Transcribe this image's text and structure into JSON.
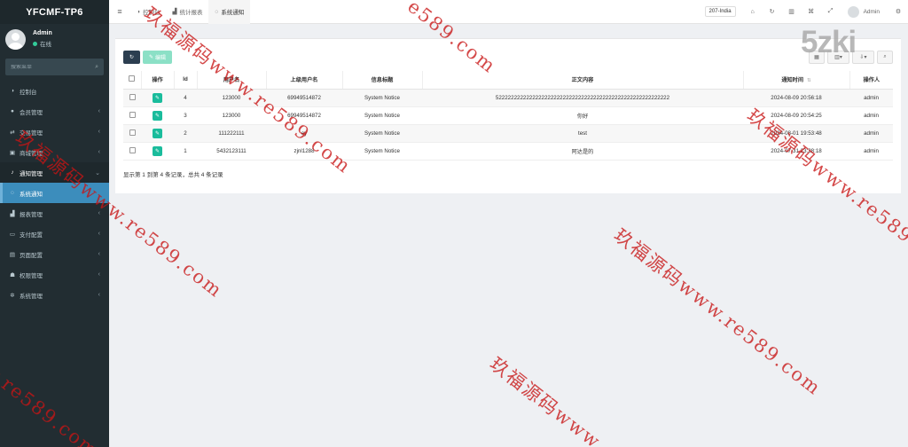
{
  "brand": "YFCMF-TP6",
  "user": {
    "name": "Admin",
    "status": "在线"
  },
  "sidebar": {
    "search_placeholder": "搜索菜单",
    "items": [
      {
        "label": "控制台",
        "icon": "dashboard-icon",
        "glyph": "◑",
        "chevron": ""
      },
      {
        "label": "会员管理",
        "icon": "user-icon",
        "glyph": "●",
        "chevron": "‹"
      },
      {
        "label": "交易管理",
        "icon": "exchange-icon",
        "glyph": "⇄",
        "chevron": "‹"
      },
      {
        "label": "商城管理",
        "icon": "shop-icon",
        "glyph": "▣",
        "chevron": "‹"
      },
      {
        "label": "通知管理",
        "icon": "bell-icon",
        "glyph": "♪",
        "chevron": "⌄"
      },
      {
        "label": "系统通知",
        "icon": "chat-icon",
        "glyph": "◌",
        "chevron": ""
      },
      {
        "label": "报表管理",
        "icon": "chart-icon",
        "glyph": "▟",
        "chevron": "‹"
      },
      {
        "label": "支付配置",
        "icon": "card-icon",
        "glyph": "▭",
        "chevron": "‹"
      },
      {
        "label": "页面配置",
        "icon": "page-icon",
        "glyph": "▤",
        "chevron": "‹"
      },
      {
        "label": "权限管理",
        "icon": "group-icon",
        "glyph": "☗",
        "chevron": "‹"
      },
      {
        "label": "系统管理",
        "icon": "cogs-icon",
        "glyph": "✲",
        "chevron": "‹"
      }
    ]
  },
  "topbar": {
    "tabs": [
      {
        "label": "控制台",
        "glyph": "◑"
      },
      {
        "label": "统计报表",
        "glyph": "▟"
      },
      {
        "label": "系统通知",
        "glyph": "◌"
      }
    ],
    "region": "207-India",
    "username": "Admin"
  },
  "toolbar": {
    "edit_label": "编辑"
  },
  "table": {
    "headers": [
      "",
      "操作",
      "Id",
      "用户名",
      "上级用户名",
      "信息标题",
      "正文内容",
      "通知时间",
      "操作人"
    ],
    "rows": [
      {
        "id": "4",
        "username": "123000",
        "parent": "69949514872",
        "title": "System Notice",
        "content": "522222222222222222222222222222222222222222222222222222222",
        "time": "2024-08-09 20:56:18",
        "operator": "admin"
      },
      {
        "id": "3",
        "username": "123000",
        "parent": "69949514872",
        "title": "System Notice",
        "content": "你好",
        "time": "2024-08-09 20:54:25",
        "operator": "admin"
      },
      {
        "id": "2",
        "username": "111222111",
        "parent": "ey",
        "title": "System Notice",
        "content": "test",
        "time": "2024-08-01 19:53:48",
        "operator": "admin"
      },
      {
        "id": "1",
        "username": "5432123111",
        "parent": "zjnl1288",
        "title": "System Notice",
        "content": "阿达是的",
        "time": "2024-07-31 23:28:18",
        "operator": "admin"
      }
    ]
  },
  "summary": "显示第 1 到第 4 条记录，总共 4 条记录",
  "watermark": {
    "logo": "5zki",
    "cn": "玖福源码",
    "url": "www.re589.com"
  },
  "colors": {
    "sidebar": "#222d32",
    "active": "#3c8dbc",
    "edit": "#1abc9c",
    "watermark": "#c81414"
  }
}
